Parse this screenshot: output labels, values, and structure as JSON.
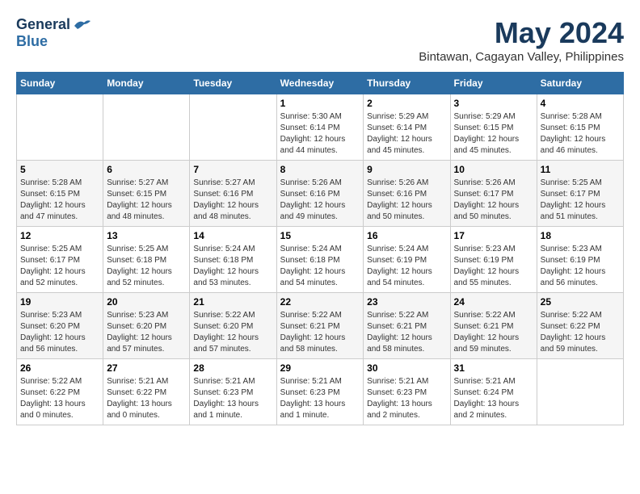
{
  "logo": {
    "general": "General",
    "blue": "Blue"
  },
  "title": {
    "month": "May 2024",
    "location": "Bintawan, Cagayan Valley, Philippines"
  },
  "weekdays": [
    "Sunday",
    "Monday",
    "Tuesday",
    "Wednesday",
    "Thursday",
    "Friday",
    "Saturday"
  ],
  "weeks": [
    [
      {
        "day": "",
        "info": ""
      },
      {
        "day": "",
        "info": ""
      },
      {
        "day": "",
        "info": ""
      },
      {
        "day": "1",
        "info": "Sunrise: 5:30 AM\nSunset: 6:14 PM\nDaylight: 12 hours\nand 44 minutes."
      },
      {
        "day": "2",
        "info": "Sunrise: 5:29 AM\nSunset: 6:14 PM\nDaylight: 12 hours\nand 45 minutes."
      },
      {
        "day": "3",
        "info": "Sunrise: 5:29 AM\nSunset: 6:15 PM\nDaylight: 12 hours\nand 45 minutes."
      },
      {
        "day": "4",
        "info": "Sunrise: 5:28 AM\nSunset: 6:15 PM\nDaylight: 12 hours\nand 46 minutes."
      }
    ],
    [
      {
        "day": "5",
        "info": "Sunrise: 5:28 AM\nSunset: 6:15 PM\nDaylight: 12 hours\nand 47 minutes."
      },
      {
        "day": "6",
        "info": "Sunrise: 5:27 AM\nSunset: 6:15 PM\nDaylight: 12 hours\nand 48 minutes."
      },
      {
        "day": "7",
        "info": "Sunrise: 5:27 AM\nSunset: 6:16 PM\nDaylight: 12 hours\nand 48 minutes."
      },
      {
        "day": "8",
        "info": "Sunrise: 5:26 AM\nSunset: 6:16 PM\nDaylight: 12 hours\nand 49 minutes."
      },
      {
        "day": "9",
        "info": "Sunrise: 5:26 AM\nSunset: 6:16 PM\nDaylight: 12 hours\nand 50 minutes."
      },
      {
        "day": "10",
        "info": "Sunrise: 5:26 AM\nSunset: 6:17 PM\nDaylight: 12 hours\nand 50 minutes."
      },
      {
        "day": "11",
        "info": "Sunrise: 5:25 AM\nSunset: 6:17 PM\nDaylight: 12 hours\nand 51 minutes."
      }
    ],
    [
      {
        "day": "12",
        "info": "Sunrise: 5:25 AM\nSunset: 6:17 PM\nDaylight: 12 hours\nand 52 minutes."
      },
      {
        "day": "13",
        "info": "Sunrise: 5:25 AM\nSunset: 6:18 PM\nDaylight: 12 hours\nand 52 minutes."
      },
      {
        "day": "14",
        "info": "Sunrise: 5:24 AM\nSunset: 6:18 PM\nDaylight: 12 hours\nand 53 minutes."
      },
      {
        "day": "15",
        "info": "Sunrise: 5:24 AM\nSunset: 6:18 PM\nDaylight: 12 hours\nand 54 minutes."
      },
      {
        "day": "16",
        "info": "Sunrise: 5:24 AM\nSunset: 6:19 PM\nDaylight: 12 hours\nand 54 minutes."
      },
      {
        "day": "17",
        "info": "Sunrise: 5:23 AM\nSunset: 6:19 PM\nDaylight: 12 hours\nand 55 minutes."
      },
      {
        "day": "18",
        "info": "Sunrise: 5:23 AM\nSunset: 6:19 PM\nDaylight: 12 hours\nand 56 minutes."
      }
    ],
    [
      {
        "day": "19",
        "info": "Sunrise: 5:23 AM\nSunset: 6:20 PM\nDaylight: 12 hours\nand 56 minutes."
      },
      {
        "day": "20",
        "info": "Sunrise: 5:23 AM\nSunset: 6:20 PM\nDaylight: 12 hours\nand 57 minutes."
      },
      {
        "day": "21",
        "info": "Sunrise: 5:22 AM\nSunset: 6:20 PM\nDaylight: 12 hours\nand 57 minutes."
      },
      {
        "day": "22",
        "info": "Sunrise: 5:22 AM\nSunset: 6:21 PM\nDaylight: 12 hours\nand 58 minutes."
      },
      {
        "day": "23",
        "info": "Sunrise: 5:22 AM\nSunset: 6:21 PM\nDaylight: 12 hours\nand 58 minutes."
      },
      {
        "day": "24",
        "info": "Sunrise: 5:22 AM\nSunset: 6:21 PM\nDaylight: 12 hours\nand 59 minutes."
      },
      {
        "day": "25",
        "info": "Sunrise: 5:22 AM\nSunset: 6:22 PM\nDaylight: 12 hours\nand 59 minutes."
      }
    ],
    [
      {
        "day": "26",
        "info": "Sunrise: 5:22 AM\nSunset: 6:22 PM\nDaylight: 13 hours\nand 0 minutes."
      },
      {
        "day": "27",
        "info": "Sunrise: 5:21 AM\nSunset: 6:22 PM\nDaylight: 13 hours\nand 0 minutes."
      },
      {
        "day": "28",
        "info": "Sunrise: 5:21 AM\nSunset: 6:23 PM\nDaylight: 13 hours\nand 1 minute."
      },
      {
        "day": "29",
        "info": "Sunrise: 5:21 AM\nSunset: 6:23 PM\nDaylight: 13 hours\nand 1 minute."
      },
      {
        "day": "30",
        "info": "Sunrise: 5:21 AM\nSunset: 6:23 PM\nDaylight: 13 hours\nand 2 minutes."
      },
      {
        "day": "31",
        "info": "Sunrise: 5:21 AM\nSunset: 6:24 PM\nDaylight: 13 hours\nand 2 minutes."
      },
      {
        "day": "",
        "info": ""
      }
    ]
  ]
}
